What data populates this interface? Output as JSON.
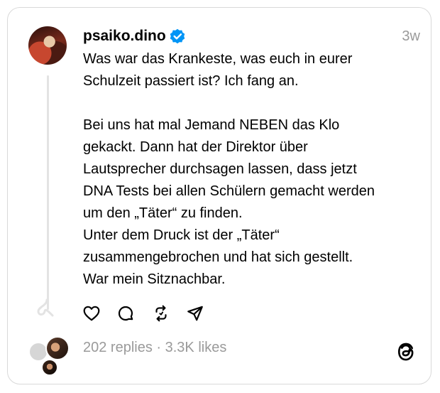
{
  "post": {
    "username": "psaiko.dino",
    "time": "3w",
    "text": "Was war das Krankeste, was euch in eurer\nSchulzeit passiert ist? Ich fang an.\n\nBei uns hat mal Jemand NEBEN das Klo\ngekackt. Dann hat der Direktor über\nLautsprecher durchsagen lassen, dass jetzt\nDNA Tests bei allen Schülern gemacht werden\num den „Täter“ zu finden.\nUnter dem Druck ist der „Täter“\nzusammengebrochen und hat sich gestellt.\nWar mein Sitznachbar."
  },
  "stats": {
    "replies": "202 replies",
    "separator": " · ",
    "likes": "3.3K likes"
  },
  "icons": {
    "like": "heart-icon",
    "comment": "comment-icon",
    "repost": "repost-icon",
    "share": "share-icon",
    "verified": "verified-badge-icon",
    "brand": "threads-logo-icon"
  },
  "colors": {
    "verified": "#0095f6",
    "muted": "#9a9a9a",
    "border": "#d9d9d9"
  }
}
